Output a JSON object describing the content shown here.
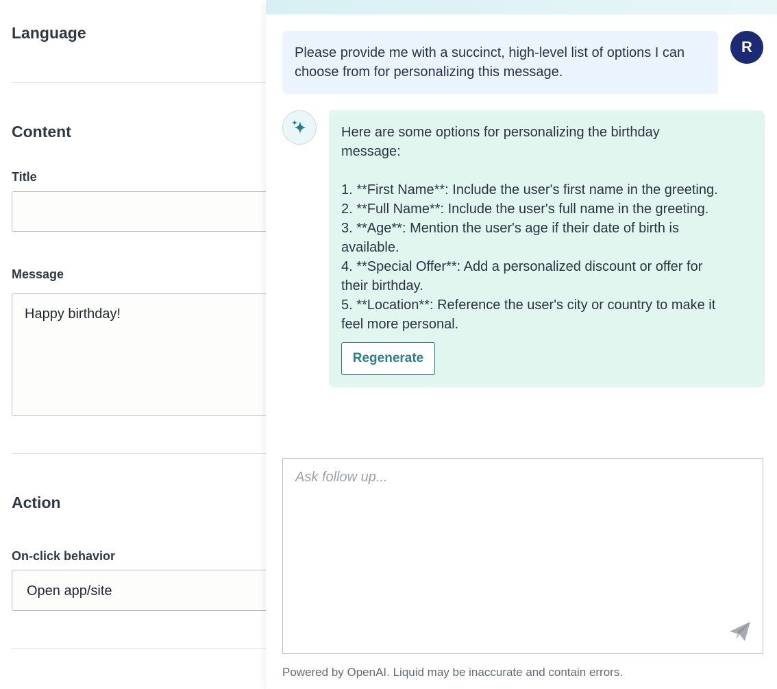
{
  "form": {
    "language_heading": "Language",
    "content_heading": "Content",
    "title_label": "Title",
    "title_value": "",
    "message_label": "Message",
    "message_value": "Happy birthday!",
    "action_heading": "Action",
    "onclick_label": "On-click behavior",
    "onclick_value": "Open app/site"
  },
  "chat": {
    "user_avatar": "R",
    "user_message": "Please provide me with a succinct, high-level list of options I can choose from for personalizing this message.",
    "ai_icon": "sparkle-icon",
    "ai_lines": [
      "Here are some options for personalizing the birthday",
      "message:",
      "",
      "1. **First Name**: Include the user's first name in the greeting.",
      "2. **Full Name**: Include the user's full name in the greeting.",
      "3. **Age**: Mention the user's age if their date of birth is",
      "available.",
      "4. **Special Offer**: Add a personalized discount or offer for",
      "their birthday.",
      "5. **Location**: Reference the user's city or country to make it",
      "feel more personal."
    ],
    "regenerate_label": "Regenerate",
    "followup_placeholder": "Ask follow up...",
    "send_icon": "send-icon",
    "footer_note": "Powered by OpenAI. Liquid may be inaccurate and contain errors."
  },
  "colors": {
    "user_bubble": "#ebf3fe",
    "ai_bubble": "#e1f6ee",
    "avatar": "#1c2a73",
    "accent": "#2b7b88"
  }
}
